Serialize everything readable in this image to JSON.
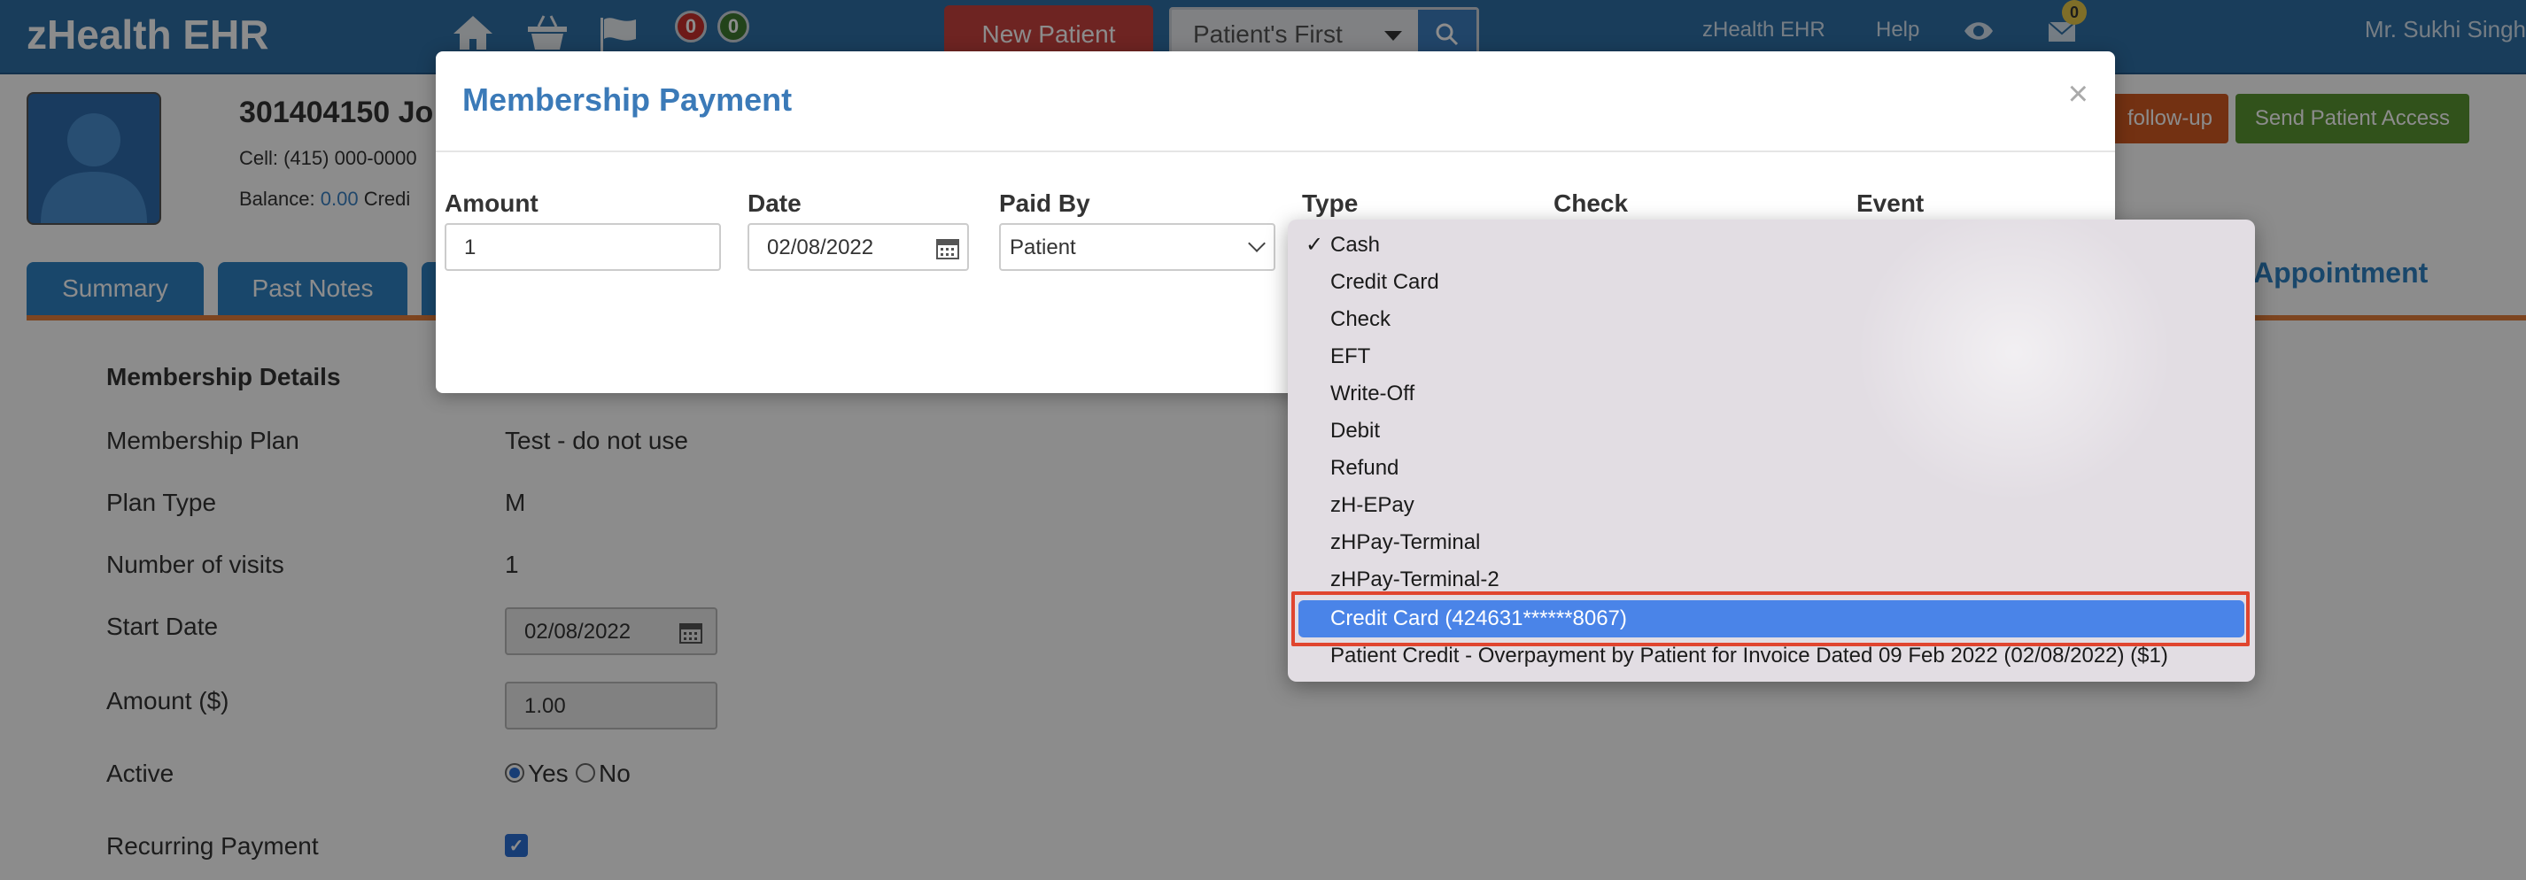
{
  "navbar": {
    "brand": "zHealth EHR",
    "badges": {
      "red_count": "0",
      "green_count": "0"
    },
    "new_patient_label": "New Patient",
    "search_select_value": "Patient's First",
    "links": {
      "zhealth": "zHealth EHR",
      "help": "Help"
    },
    "mail_count": "0",
    "user": "Mr. Sukhi Singh"
  },
  "patient": {
    "id_name": "301404150 Jo",
    "cell": "Cell: (415) 000-0000",
    "balance_label": "Balance:",
    "balance_value": "0.00",
    "balance_suffix": "Credi",
    "followup_label": "follow-up",
    "send_access_label": "Send Patient Access"
  },
  "tabs": {
    "summary": "Summary",
    "past_notes": "Past Notes",
    "appointment": "Appointment"
  },
  "membership": {
    "section_title": "Membership Details",
    "plan_label": "Membership Plan",
    "plan_value": "Test - do not use",
    "type_label": "Plan Type",
    "type_value": "M",
    "visits_label": "Number of visits",
    "visits_value": "1",
    "start_label": "Start Date",
    "start_value": "02/08/2022",
    "amount_label": "Amount ($)",
    "amount_value": "1.00",
    "active_label": "Active",
    "active_yes": "Yes",
    "active_no": "No",
    "recurring_label": "Recurring Payment"
  },
  "modal": {
    "title": "Membership Payment",
    "close": "×",
    "amount_label": "Amount",
    "amount_value": "1",
    "date_label": "Date",
    "date_value": "02/08/2022",
    "paid_by_label": "Paid By",
    "paid_by_value": "Patient",
    "type_label": "Type",
    "check_label": "Check",
    "event_label": "Event"
  },
  "type_dropdown": {
    "selected": "Cash",
    "highlighted": "Credit Card (424631******8067)",
    "options": [
      "Cash",
      "Credit Card",
      "Check",
      "EFT",
      "Write-Off",
      "Debit",
      "Refund",
      "zH-EPay",
      "zHPay-Terminal",
      "zHPay-Terminal-2",
      "Credit Card (424631******8067)",
      "Patient Credit - Overpayment by Patient for Invoice Dated 09 Feb 2022 (02/08/2022) ($1)"
    ]
  },
  "colors": {
    "navbar": "#2f6fa7",
    "accent_blue": "#2f81c4",
    "highlight": "#4a84e8",
    "annotation_red": "#e0452f"
  }
}
